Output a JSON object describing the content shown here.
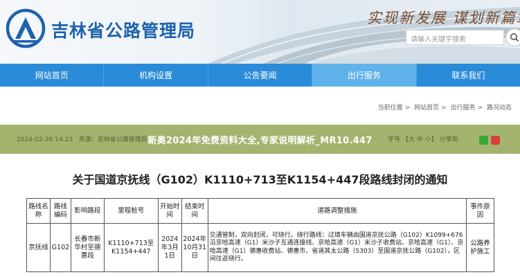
{
  "header": {
    "site_name": "吉林省公路管理局",
    "slogan": "实现新发展 谋划新篇章",
    "search_placeholder": "请输入关键字搜索"
  },
  "nav": {
    "items": [
      {
        "label": "网站首页",
        "active": false
      },
      {
        "label": "机构设置",
        "active": false
      },
      {
        "label": "公告要闻",
        "active": false
      },
      {
        "label": "出行服务",
        "active": true
      },
      {
        "label": "联系我们",
        "active": false
      }
    ]
  },
  "breadcrumb": {
    "prefix": "当前位置",
    "items": [
      "网站首页",
      "出行服务",
      "路况动态"
    ]
  },
  "article_meta": {
    "date": "2024-02-26 14:23",
    "source": "来源：吉林省公路管理局",
    "font_size_label": "字号",
    "font_sizes": [
      "大",
      "中",
      "小"
    ],
    "share_label": "分享到"
  },
  "overlay_title": "新奥2024年免费资料大全,专家说明解析_MR10.447",
  "article_title": "关于国道京抚线（G102）K1110+713至K1154+447段路线封闭的通知",
  "table": {
    "headers": [
      "路线名称",
      "路线编码",
      "影响路段",
      "里程桩号",
      "开始时间",
      "结束时间",
      "道路调整措施",
      "事件原因"
    ],
    "row": {
      "route_name": "京抚线",
      "route_code": "G102",
      "affected_section": "长春市新华村至德惠段",
      "stake": "K1110+713至K1154+447",
      "start_time": "2024年3月1日",
      "end_time": "2024年10月31日",
      "measures": "交通管制，双向封闭，可绕行。绕行路线：过境车辆由国道京抚公路（G102）K1099+676沿京哈高速（G1）米沙子互通连接线、京哈高速（G1）米沙子收费站、京哈高速（G1）、京哈高速（G1）德惠收费站、德惠市、省道其太公路（S303）至国道京抚公路（G102），区间往返绕行。",
      "reason": "公路养护施工"
    }
  },
  "colors": {
    "brand_blue": "#1d62ae",
    "nav_blue": "#2a8bd8",
    "nav_active": "#5fb2ea",
    "overlay_green": "#96aa5a"
  }
}
